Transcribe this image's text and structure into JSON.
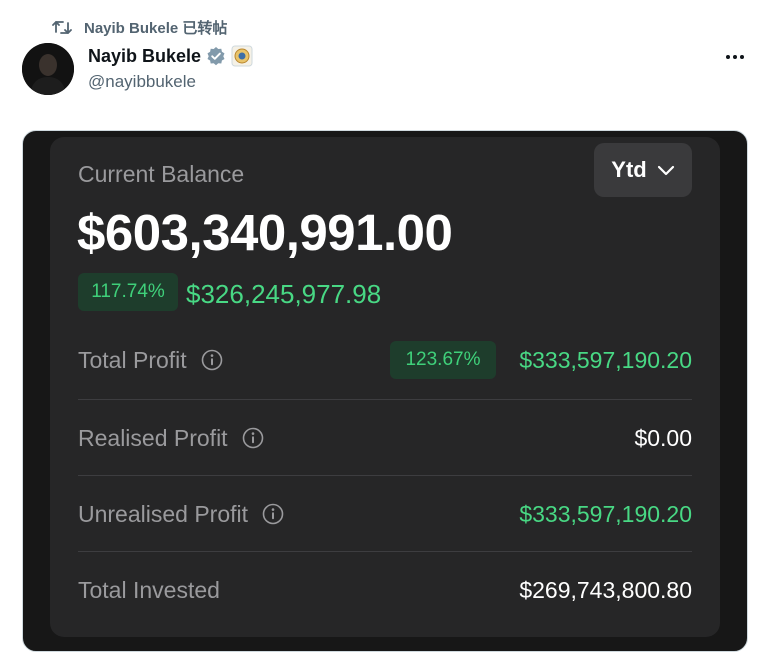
{
  "repost": {
    "text": "Nayib Bukele 已转帖",
    "icon": "repost-icon"
  },
  "author": {
    "name": "Nayib Bukele",
    "handle": "@nayibbukele",
    "verified_icon": "verified-badge-icon",
    "affiliate_icon": "government-seal-icon"
  },
  "more_icon": "more-options-icon",
  "card": {
    "balance_label": "Current Balance",
    "period_selector": {
      "value": "Ytd",
      "icon": "chevron-down-icon"
    },
    "balance": "$603,340,991.00",
    "change_percent": "117.74%",
    "change_amount": "$326,245,977.98",
    "rows": [
      {
        "label": "Total Profit",
        "has_info": true,
        "percent": "123.67%",
        "value": "$333,597,190.20",
        "value_color": "green"
      },
      {
        "label": "Realised Profit",
        "has_info": true,
        "value": "$0.00",
        "value_color": "white"
      },
      {
        "label": "Unrealised Profit",
        "has_info": true,
        "value": "$333,597,190.20",
        "value_color": "green"
      },
      {
        "label": "Total Invested",
        "has_info": false,
        "value": "$269,743,800.80",
        "value_color": "white"
      }
    ]
  },
  "colors": {
    "card_bg": "#262627",
    "positive": "#48d884",
    "badge_bg": "#1e3d2c",
    "muted": "#9a9a9d"
  }
}
